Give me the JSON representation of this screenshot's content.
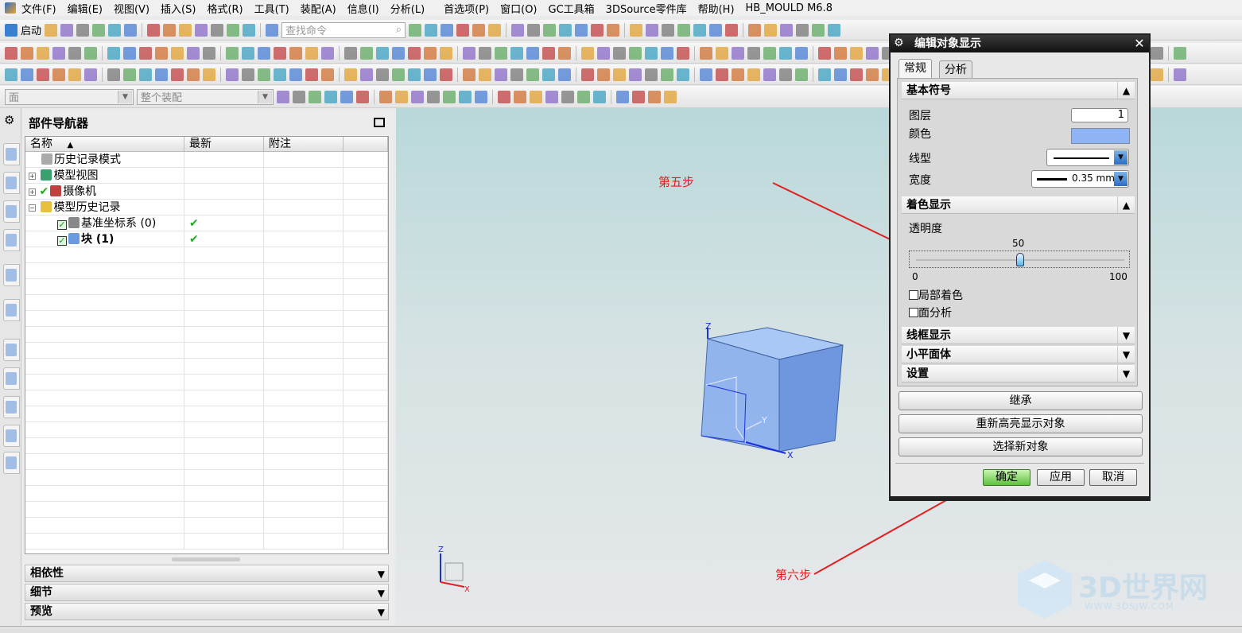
{
  "menu": [
    "文件(F)",
    "编辑(E)",
    "视图(V)",
    "插入(S)",
    "格式(R)",
    "工具(T)",
    "装配(A)",
    "信息(I)",
    "分析(L)",
    "首选项(P)",
    "窗口(O)",
    "GC工具箱",
    "3DSource零件库",
    "帮助(H)",
    "HB_MOULD M6.8"
  ],
  "toolbar": {
    "start_label": "启动",
    "search_placeholder": "查找命令",
    "filter_type": "面",
    "filter_scope": "整个装配"
  },
  "navigator": {
    "title": "部件导航器",
    "columns": [
      "名称",
      "最新",
      "附注"
    ],
    "rows": [
      {
        "name": "历史记录模式",
        "latest": "",
        "icon": "clock-icon"
      },
      {
        "name": "模型视图",
        "latest": "",
        "icon": "model-view-icon",
        "expander": "+"
      },
      {
        "name": "摄像机",
        "latest": "",
        "icon": "camera-icon",
        "expander": "+"
      },
      {
        "name": "模型历史记录",
        "latest": "",
        "icon": "folder-icon",
        "expander": "-"
      },
      {
        "name": "基准坐标系 (0)",
        "latest": "✔",
        "icon": "datum-csys-icon",
        "checked": true
      },
      {
        "name": "块 (1)",
        "latest": "✔",
        "icon": "block-icon",
        "checked": true
      }
    ],
    "panels": [
      "相依性",
      "细节",
      "预览"
    ]
  },
  "dialog": {
    "title": "编辑对象显示",
    "tabs": [
      "常规",
      "分析"
    ],
    "basic_section": "基本符号",
    "layer_label": "图层",
    "layer_value": "1",
    "color_label": "颜色",
    "color_value": "#8fb4f5",
    "linetype_label": "线型",
    "width_label": "宽度",
    "width_value": "0.35 mm",
    "shading_section": "着色显示",
    "transparency_label": "透明度",
    "transparency_value": "50",
    "transparency_min": "0",
    "transparency_max": "100",
    "partial_shading": "局部着色",
    "face_analysis": "面分析",
    "collapsed_sections": [
      "线框显示",
      "小平面体",
      "设置"
    ],
    "buttons": [
      "继承",
      "重新高亮显示对象",
      "选择新对象"
    ],
    "ok": "确定",
    "apply": "应用",
    "cancel": "取消"
  },
  "viewport": {
    "axis_z": "Z",
    "axis_x": "X",
    "axis_y": "Y",
    "block_color": "#7ea6ec"
  },
  "annotations": {
    "step5": "第五步",
    "step6": "第六步"
  },
  "watermark": {
    "name": "3D世界网",
    "url": "WWW.3DSJW.COM"
  }
}
